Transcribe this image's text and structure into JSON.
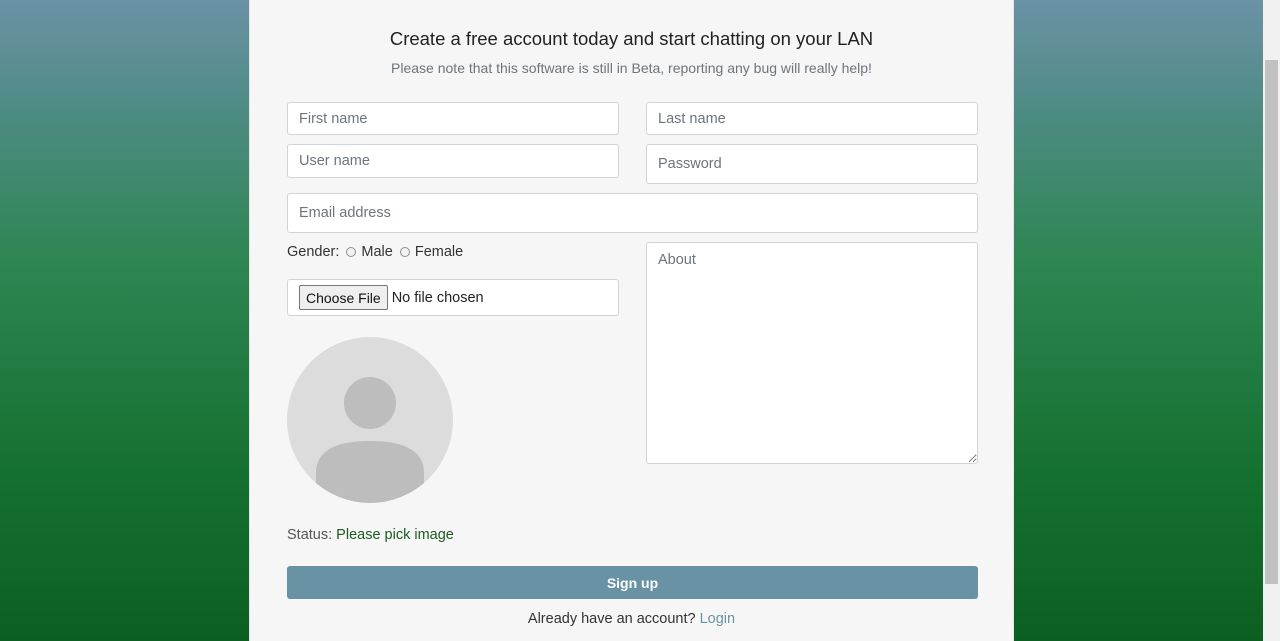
{
  "header": {
    "title": "Create a free account today and start chatting on your LAN",
    "subtitle": "Please note that this software is still in Beta, reporting any bug will really help!"
  },
  "form": {
    "first_name_placeholder": "First name",
    "last_name_placeholder": "Last name",
    "username_placeholder": "User name",
    "password_placeholder": "Password",
    "email_placeholder": "Email address",
    "about_placeholder": "About",
    "gender_label": "Gender:",
    "gender_options": [
      "Male",
      "Female"
    ],
    "file_button_label": "Choose File",
    "file_status": "No file chosen",
    "status_label": "Status:",
    "status_value": "Please pick image",
    "signup_label": "Sign up"
  },
  "footer": {
    "prompt": "Already have an account?",
    "login_link": "Login"
  },
  "colors": {
    "accent": "#6993a4",
    "status_value": "#1d5a25"
  }
}
